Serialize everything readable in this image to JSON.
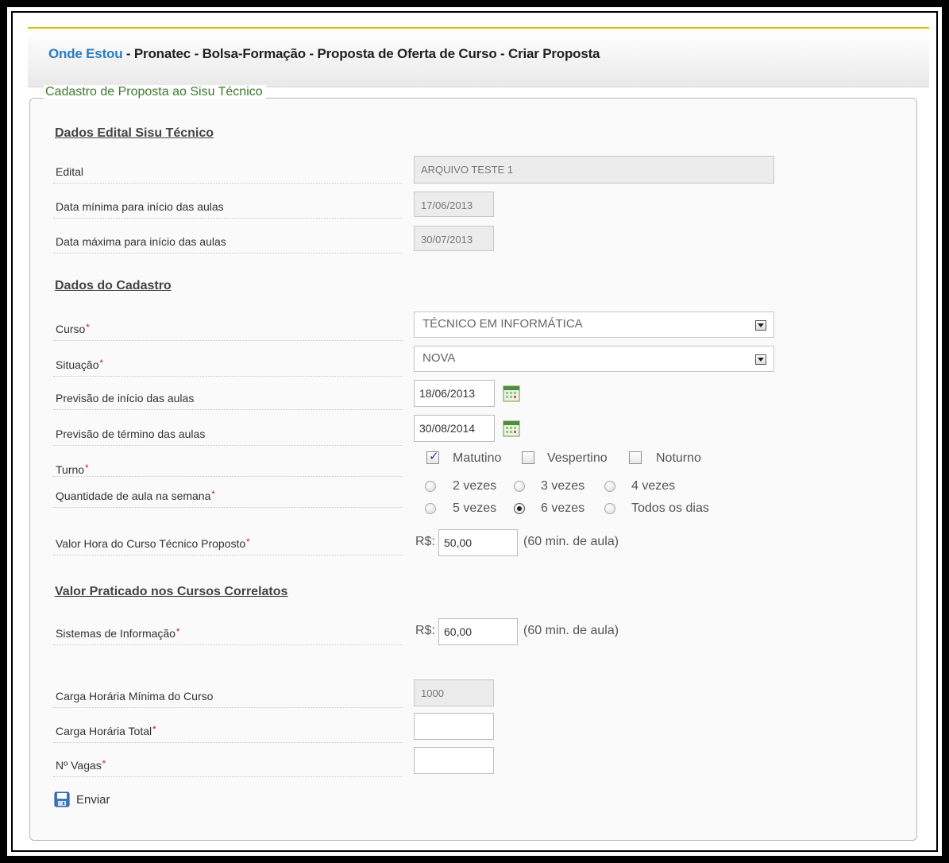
{
  "breadcrumb": {
    "here": "Onde Estou",
    "path": " - Pronatec - Bolsa-Formação - Proposta de Oferta de Curso - Criar Proposta"
  },
  "form": {
    "legend": "Cadastro de Proposta ao Sisu Técnico",
    "sections": {
      "edital": "Dados Edital Sisu Técnico",
      "cadastro": "Dados do Cadastro",
      "correlatos": "Valor Praticado nos Cursos Correlatos"
    },
    "edital": {
      "label": "Edital",
      "value": "ARQUIVO TESTE 1"
    },
    "data_min": {
      "label": "Data mínima para início das aulas",
      "value": "17/06/2013"
    },
    "data_max": {
      "label": "Data máxima para início das aulas",
      "value": "30/07/2013"
    },
    "curso": {
      "label": "Curso",
      "value": "TÉCNICO EM INFORMÁTICA"
    },
    "situacao": {
      "label": "Situação",
      "value": "NOVA"
    },
    "prev_inicio": {
      "label": "Previsão de início das aulas",
      "value": "18/06/2013"
    },
    "prev_termino": {
      "label": "Previsão de término das aulas",
      "value": "30/08/2014"
    },
    "turno": {
      "label": "Turno",
      "options": [
        {
          "label": "Matutino",
          "checked": true
        },
        {
          "label": "Vespertino",
          "checked": false
        },
        {
          "label": "Noturno",
          "checked": false
        }
      ]
    },
    "quantidade": {
      "label": "Quantidade de aula na semana",
      "options": [
        "2 vezes",
        "3 vezes",
        "4 vezes",
        "5 vezes",
        "6 vezes",
        "Todos os dias"
      ],
      "selected": "6 vezes"
    },
    "valor_hora": {
      "label": "Valor Hora do Curso Técnico Proposto",
      "prefix": "R$:",
      "value": "50,00",
      "suffix": "(60 min. de aula)"
    },
    "sistemas": {
      "label": "Sistemas de Informação",
      "prefix": "R$:",
      "value": "60,00",
      "suffix": "(60 min. de aula)"
    },
    "carga_min": {
      "label": "Carga Horária Mínima do Curso",
      "value": "1000"
    },
    "carga_total": {
      "label": "Carga Horária Total",
      "value": ""
    },
    "vagas": {
      "label": "Nº Vagas",
      "value": ""
    },
    "submit_label": "Enviar",
    "required_mark": "*"
  }
}
